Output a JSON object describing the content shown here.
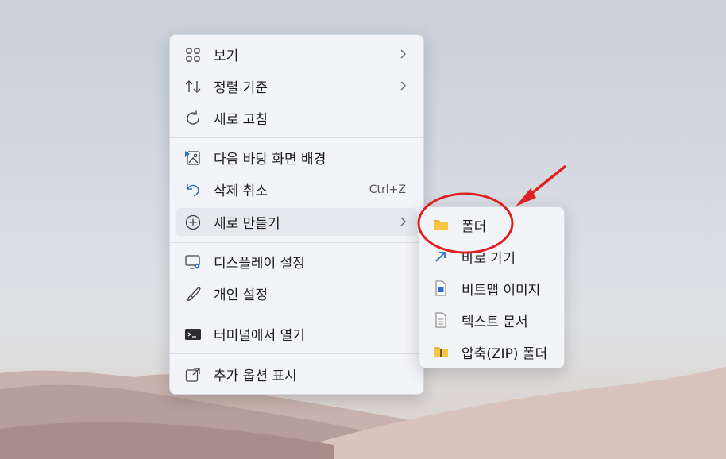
{
  "context_menu": {
    "items": [
      {
        "label": "보기",
        "icon": "view-grid-icon",
        "has_submenu": true
      },
      {
        "label": "정렬 기준",
        "icon": "sort-arrows-icon",
        "has_submenu": true
      },
      {
        "label": "새로 고침",
        "icon": "refresh-icon",
        "has_submenu": false
      },
      {
        "label": "다음 바탕 화면 배경",
        "icon": "next-wallpaper-icon",
        "has_submenu": false
      },
      {
        "label": "삭제 취소",
        "icon": "undo-icon",
        "shortcut": "Ctrl+Z"
      },
      {
        "label": "새로 만들기",
        "icon": "add-circle-icon",
        "has_submenu": true,
        "highlighted": true
      },
      {
        "label": "디스플레이 설정",
        "icon": "display-settings-icon"
      },
      {
        "label": "개인 설정",
        "icon": "brush-icon"
      },
      {
        "label": "터미널에서 열기",
        "icon": "terminal-icon"
      },
      {
        "label": "추가 옵션 표시",
        "icon": "more-options-icon"
      }
    ]
  },
  "submenu": {
    "items": [
      {
        "label": "폴더",
        "icon": "folder-icon"
      },
      {
        "label": "바로 가기",
        "icon": "shortcut-icon"
      },
      {
        "label": "비트맵 이미지",
        "icon": "bitmap-icon"
      },
      {
        "label": "텍스트 문서",
        "icon": "text-document-icon"
      },
      {
        "label": "압축(ZIP) 폴더",
        "icon": "zip-folder-icon"
      }
    ]
  },
  "colors": {
    "annotation": "#e02020",
    "accent": "#2b6cc4",
    "folder": "#f4c542"
  }
}
